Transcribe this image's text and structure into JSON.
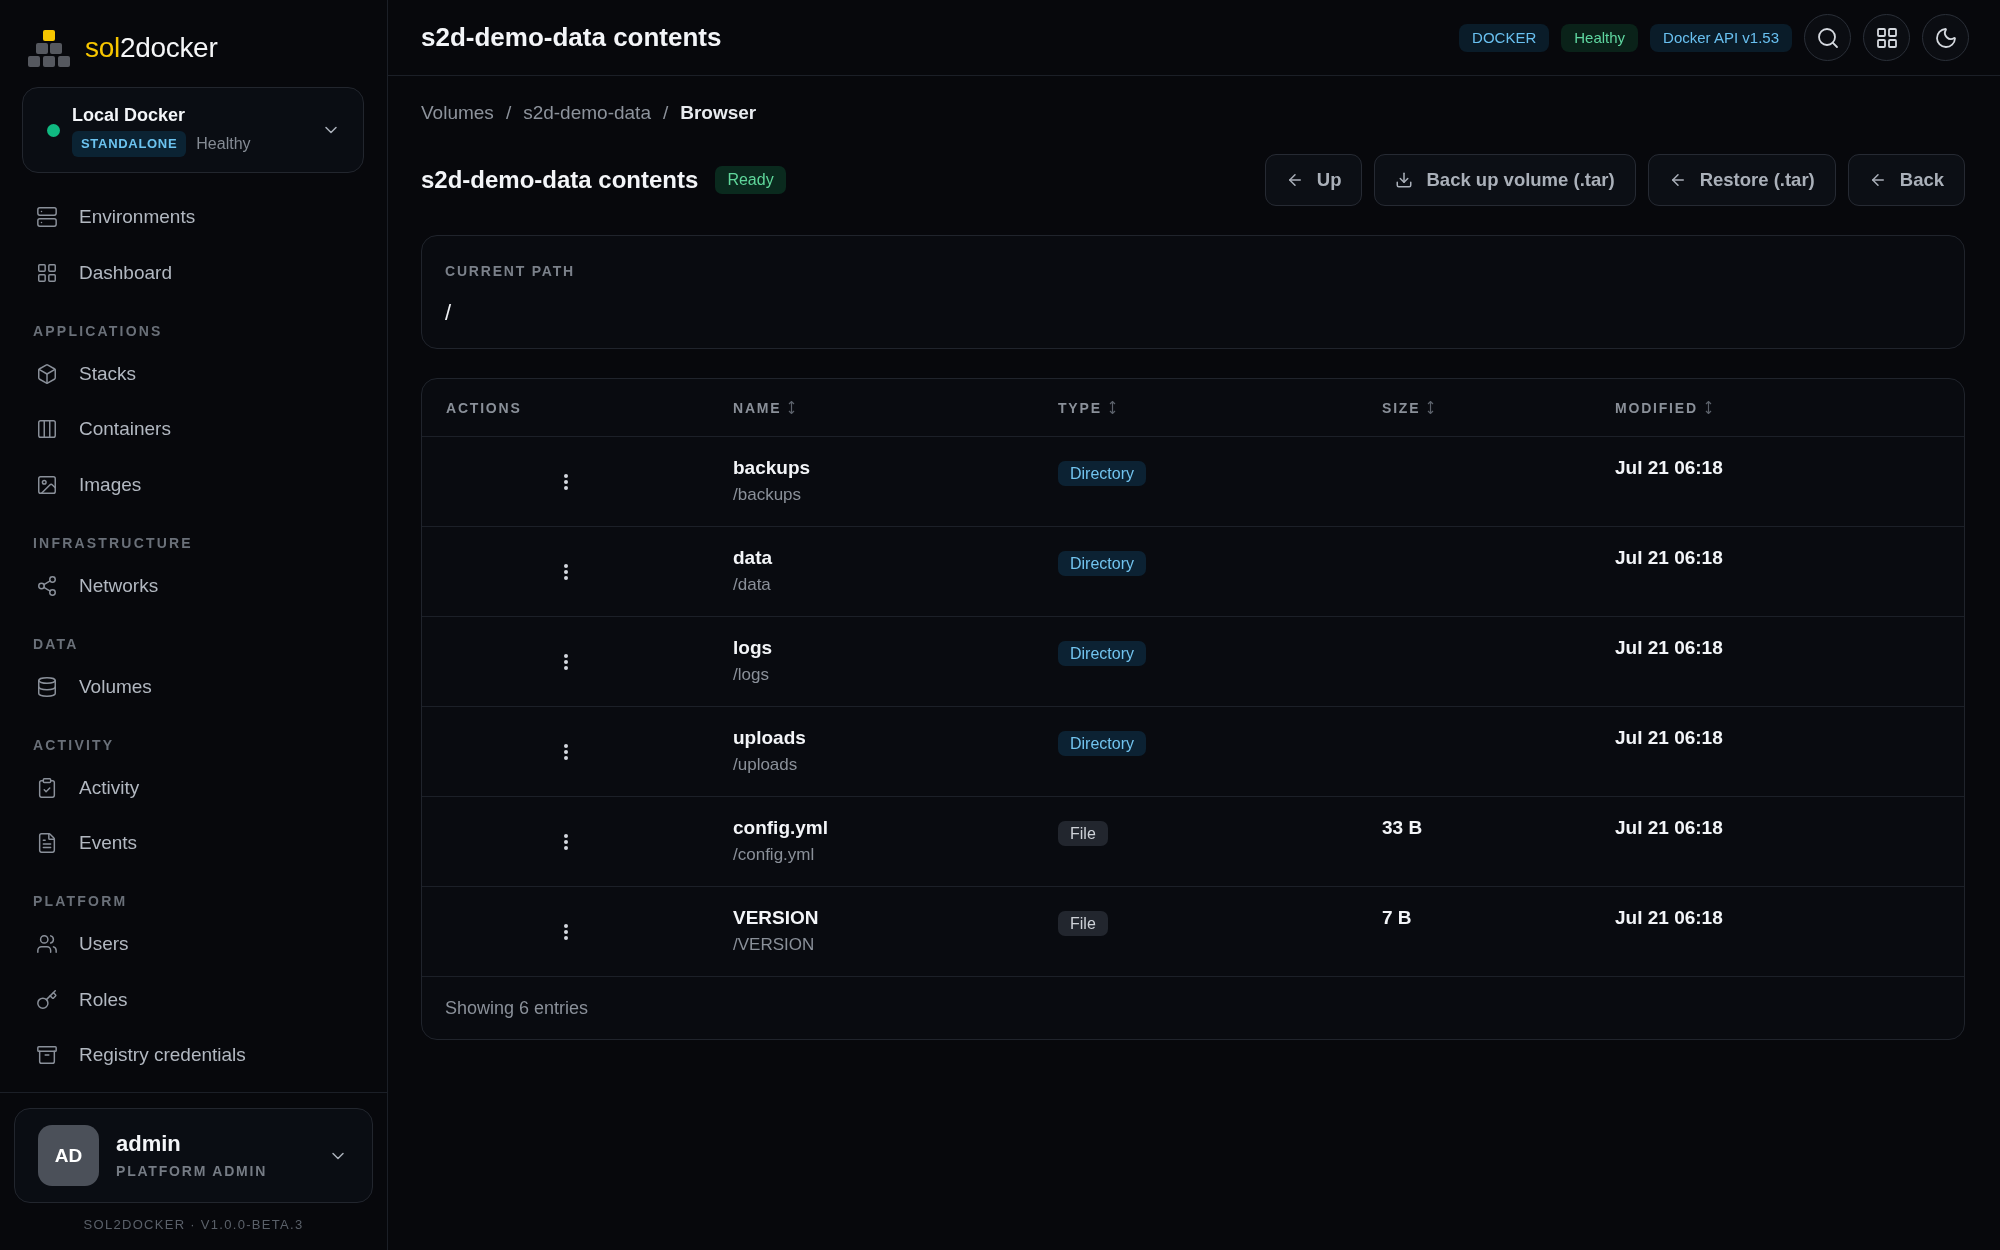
{
  "sidebar": {
    "logo": {
      "accent": "sol",
      "rest": "2docker"
    },
    "environment": {
      "name": "Local Docker",
      "mode": "STANDALONE",
      "status": "Healthy",
      "online": true
    },
    "sections": [
      {
        "items": [
          {
            "label": "Environments"
          },
          {
            "label": "Dashboard"
          }
        ]
      },
      {
        "title": "APPLICATIONS",
        "items": [
          {
            "label": "Stacks"
          },
          {
            "label": "Containers"
          },
          {
            "label": "Images"
          }
        ]
      },
      {
        "title": "INFRASTRUCTURE",
        "items": [
          {
            "label": "Networks"
          }
        ]
      },
      {
        "title": "DATA",
        "items": [
          {
            "label": "Volumes"
          }
        ]
      },
      {
        "title": "ACTIVITY",
        "items": [
          {
            "label": "Activity"
          },
          {
            "label": "Events"
          }
        ]
      },
      {
        "title": "PLATFORM",
        "items": [
          {
            "label": "Users"
          },
          {
            "label": "Roles"
          },
          {
            "label": "Registry credentials"
          }
        ]
      }
    ],
    "user": {
      "initials": "AD",
      "name": "admin",
      "role": "PLATFORM ADMIN"
    },
    "version": "SOL2DOCKER · V1.0.0-BETA.3"
  },
  "topbar": {
    "title": "s2d-demo-data contents",
    "badges": [
      {
        "text": "DOCKER",
        "kind": "info"
      },
      {
        "text": "Healthy",
        "kind": "success"
      },
      {
        "text": "Docker API v1.53",
        "kind": "info"
      }
    ]
  },
  "breadcrumb": {
    "separator": "/",
    "items": [
      {
        "label": "Volumes",
        "current": false
      },
      {
        "label": "s2d-demo-data",
        "current": false
      },
      {
        "label": "Browser",
        "current": true
      }
    ]
  },
  "page": {
    "title": "s2d-demo-data contents",
    "status": "Ready",
    "actions": [
      {
        "label": "Up"
      },
      {
        "label": "Back up volume (.tar)"
      },
      {
        "label": "Restore (.tar)"
      },
      {
        "label": "Back"
      }
    ]
  },
  "path": {
    "label": "CURRENT PATH",
    "value": "/"
  },
  "table": {
    "columns": [
      {
        "label": "ACTIONS",
        "sortable": false
      },
      {
        "label": "NAME",
        "sortable": true
      },
      {
        "label": "TYPE",
        "sortable": true
      },
      {
        "label": "SIZE",
        "sortable": true
      },
      {
        "label": "MODIFIED",
        "sortable": true
      }
    ],
    "rows": [
      {
        "name": "backups",
        "path": "/backups",
        "type": {
          "label": "Directory",
          "kind": "directory"
        },
        "modified": "Jul 21 06:18"
      },
      {
        "name": "data",
        "path": "/data",
        "type": {
          "label": "Directory",
          "kind": "directory"
        },
        "modified": "Jul 21 06:18"
      },
      {
        "name": "logs",
        "path": "/logs",
        "type": {
          "label": "Directory",
          "kind": "directory"
        },
        "modified": "Jul 21 06:18"
      },
      {
        "name": "uploads",
        "path": "/uploads",
        "type": {
          "label": "Directory",
          "kind": "directory"
        },
        "modified": "Jul 21 06:18"
      },
      {
        "name": "config.yml",
        "path": "/config.yml",
        "type": {
          "label": "File",
          "kind": "file"
        },
        "size": "33 B",
        "modified": "Jul 21 06:18"
      },
      {
        "name": "VERSION",
        "path": "/VERSION",
        "type": {
          "label": "File",
          "kind": "file"
        },
        "size": "7 B",
        "modified": "Jul 21 06:18"
      }
    ],
    "footer": "Showing 6 entries"
  }
}
